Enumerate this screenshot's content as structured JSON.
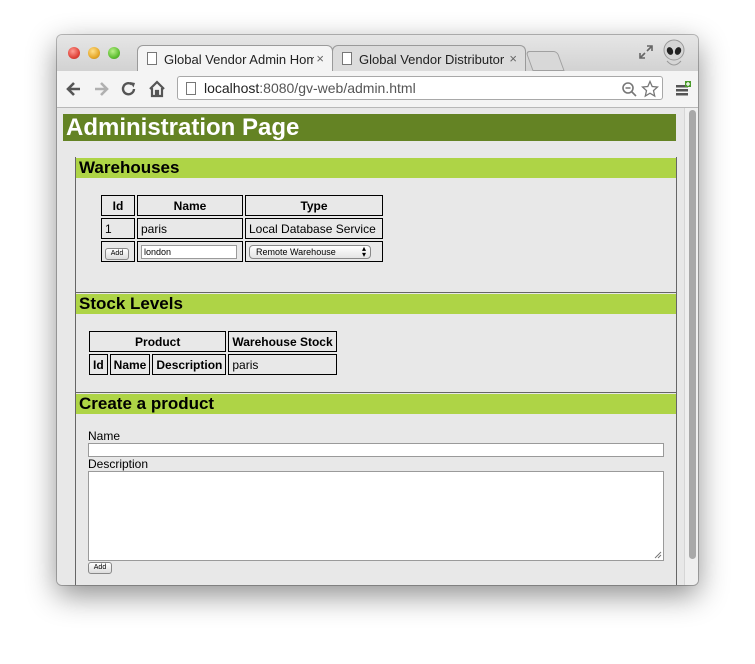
{
  "browser": {
    "tabs": [
      {
        "label": "Global Vendor Admin Hom",
        "close": "×",
        "active": true
      },
      {
        "label": "Global Vendor Distributor",
        "close": "×",
        "active": false
      }
    ],
    "url": {
      "host": "localhost",
      "rest": ":8080/gv-web/admin.html"
    },
    "icons": {
      "back": "back-arrow-icon",
      "forward": "forward-arrow-icon",
      "reload": "reload-icon",
      "home": "home-icon",
      "zoom": "zoom-icon",
      "bookmark": "star-icon",
      "menu": "wrench-menu-icon",
      "profile": "alien-avatar-icon",
      "fullscreen": "fullscreen-icon"
    }
  },
  "page": {
    "title": "Administration Page",
    "colors": {
      "title_bg": "#648324",
      "section_bg": "#aed446"
    }
  },
  "warehouses": {
    "heading": "Warehouses",
    "columns": [
      "Id",
      "Name",
      "Type"
    ],
    "rows": [
      {
        "id": "1",
        "name": "paris",
        "type": "Local Database Service"
      }
    ],
    "new_row": {
      "add_label": "Add",
      "name_value": "london",
      "type_selected": "Remote Warehouse"
    }
  },
  "stock": {
    "heading": "Stock Levels",
    "group_product": "Product",
    "group_warehouse": "Warehouse Stock",
    "columns": [
      "Id",
      "Name",
      "Description"
    ],
    "warehouse_columns": [
      "paris"
    ]
  },
  "create_product": {
    "heading": "Create a product",
    "name_label": "Name",
    "name_value": "",
    "description_label": "Description",
    "description_value": "",
    "add_label": "Add"
  }
}
